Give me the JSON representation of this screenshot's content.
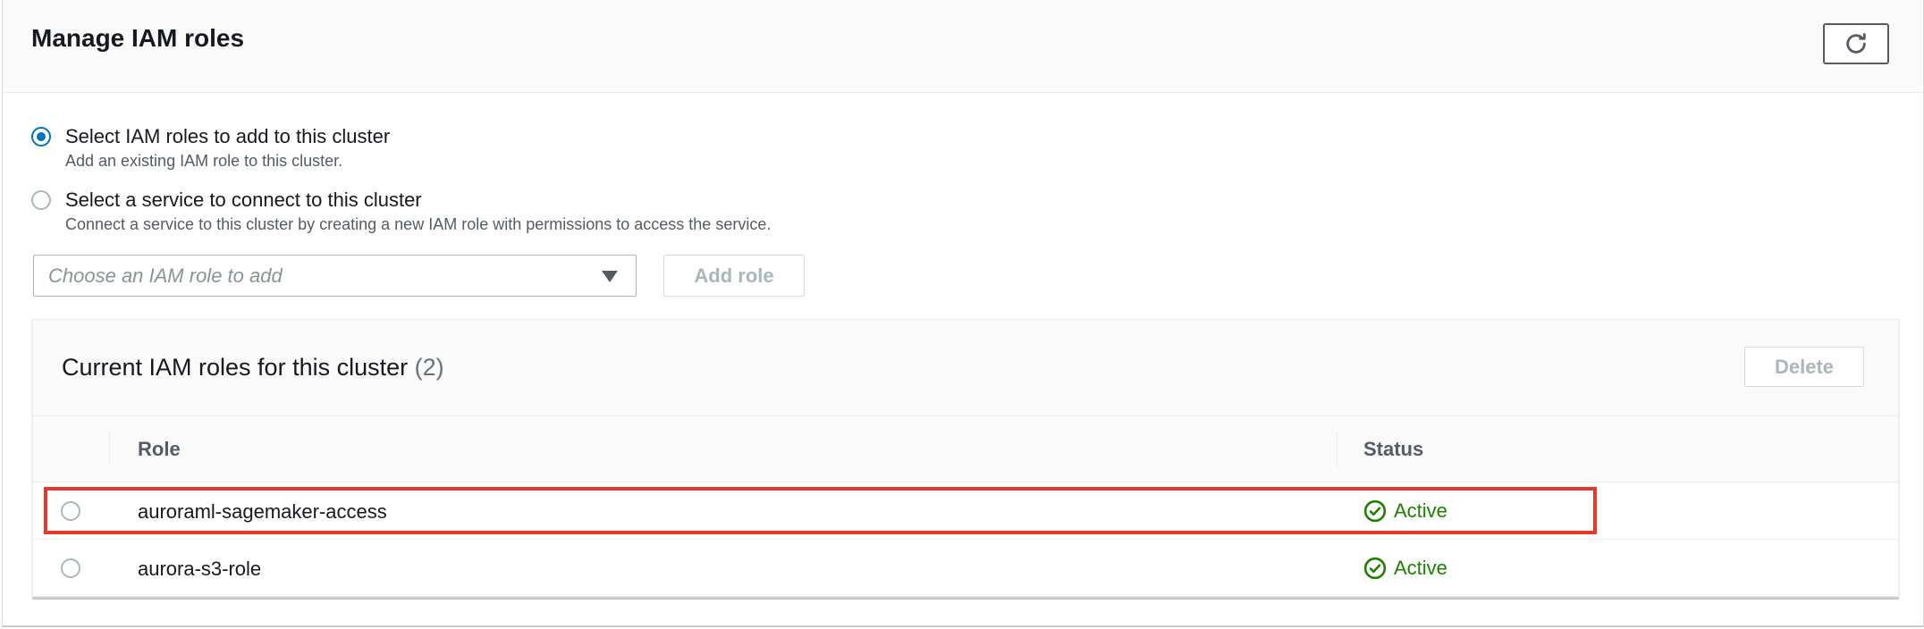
{
  "panel": {
    "title": "Manage IAM roles"
  },
  "options": [
    {
      "label": "Select IAM roles to add to this cluster",
      "description": "Add an existing IAM role to this cluster.",
      "selected": true
    },
    {
      "label": "Select a service to connect to this cluster",
      "description": "Connect a service to this cluster by creating a new IAM role with permissions to access the service.",
      "selected": false
    }
  ],
  "role_select": {
    "placeholder": "Choose an IAM role to add"
  },
  "add_role_button": {
    "label": "Add role"
  },
  "roles_table": {
    "title": "Current IAM roles for this cluster",
    "count": "(2)",
    "delete_label": "Delete",
    "columns": [
      "Role",
      "Status"
    ],
    "rows": [
      {
        "role": "auroraml-sagemaker-access",
        "status": "Active",
        "highlighted": true
      },
      {
        "role": "aurora-s3-role",
        "status": "Active",
        "highlighted": false
      }
    ]
  },
  "colors": {
    "primary_blue": "#0073bb",
    "success_green": "#1d8102",
    "highlight_red": "#e53a2a",
    "disabled_text": "#aab7b8"
  },
  "icons": {
    "refresh": "refresh-icon",
    "dropdown": "caret-down-icon",
    "status": "check-circle-icon"
  }
}
